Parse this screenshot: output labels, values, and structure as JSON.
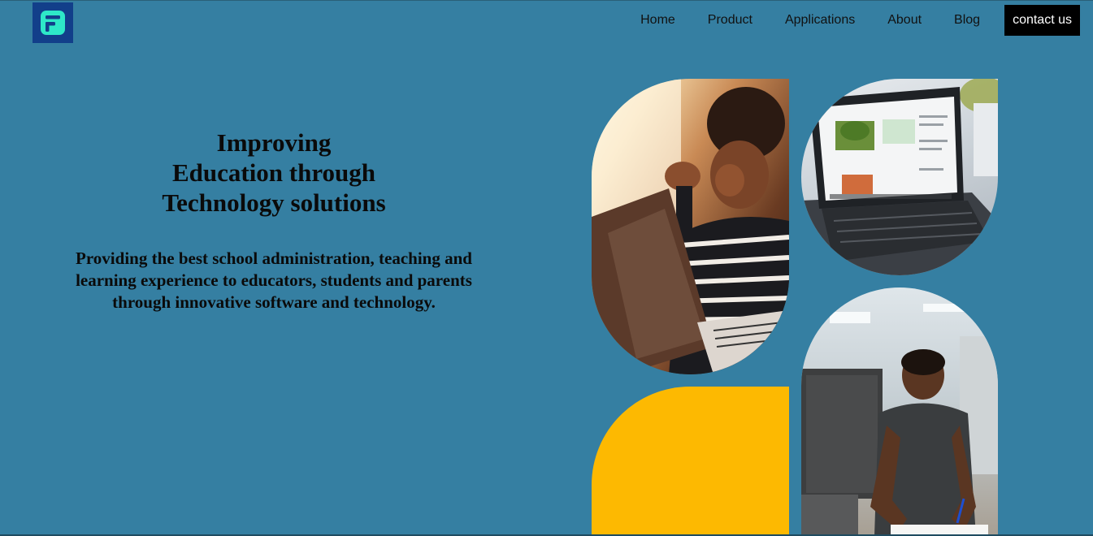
{
  "brand": {
    "logo_icon": "brand-f-logo-icon",
    "logo_bg": "#123f8a",
    "logo_fg": "#2ee8c8"
  },
  "nav": {
    "items": [
      {
        "label": "Home"
      },
      {
        "label": "Product"
      },
      {
        "label": "Applications"
      },
      {
        "label": "About"
      },
      {
        "label": "Blog"
      }
    ],
    "contact_label": "contact us"
  },
  "hero": {
    "title_lines": [
      "Improving",
      "Education through",
      "Technology solutions"
    ],
    "subtitle": "Providing the best school administration, teaching and learning experience to educators, students and parents through innovative software and technology."
  },
  "colors": {
    "background": "#357fa2",
    "accent_yellow": "#fdb901",
    "button_bg": "#000000",
    "button_text": "#ffffff"
  },
  "images": [
    {
      "name": "girl-on-laptop-photo"
    },
    {
      "name": "laptop-screen-photo"
    },
    {
      "name": "man-writing-photo"
    }
  ]
}
